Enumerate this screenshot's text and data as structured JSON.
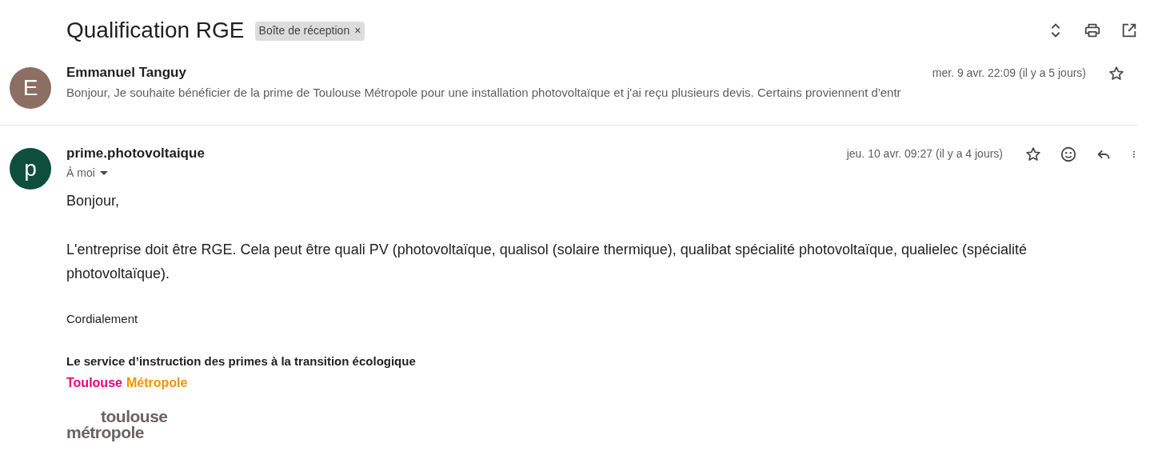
{
  "thread": {
    "subject": "Qualification RGE",
    "label": "Boîte de réception",
    "label_remove": "×"
  },
  "messages": [
    {
      "kind": "collapsed",
      "avatar_letter": "E",
      "color": "#8d6e63",
      "sender": "Emmanuel Tanguy",
      "date": "mer. 9 avr. 22:09 (il y a 5 jours)",
      "snippet": "Bonjour, Je souhaite bénéficier de la prime de Toulouse Métropole pour une installation photovoltaïque et j'ai reçu plusieurs devis. Certains proviennent d'entr",
      "starred": false
    },
    {
      "kind": "expanded",
      "avatar_letter": "p",
      "color": "#0d4f3c",
      "sender": "prime.photovoltaique",
      "date": "jeu. 10 avr. 09:27 (il y a 4 jours)",
      "recipient": "À moi",
      "starred": false,
      "body": [
        "Bonjour,",
        "L'entreprise doit être RGE. Cela peut être quali PV (photovoltaïque, qualisol (solaire thermique), qualibat spécialité photovoltaïque, qualielec (spécialité photovoltaïque)."
      ],
      "closing": "Cordialement",
      "signature": {
        "title": "Le service d’instruction des primes à la transition écologique",
        "org_part_1": "Toulouse",
        "org_part_2": "Métropole",
        "logo_line_1": "toulouse",
        "logo_line_2": "métropole"
      }
    }
  ]
}
